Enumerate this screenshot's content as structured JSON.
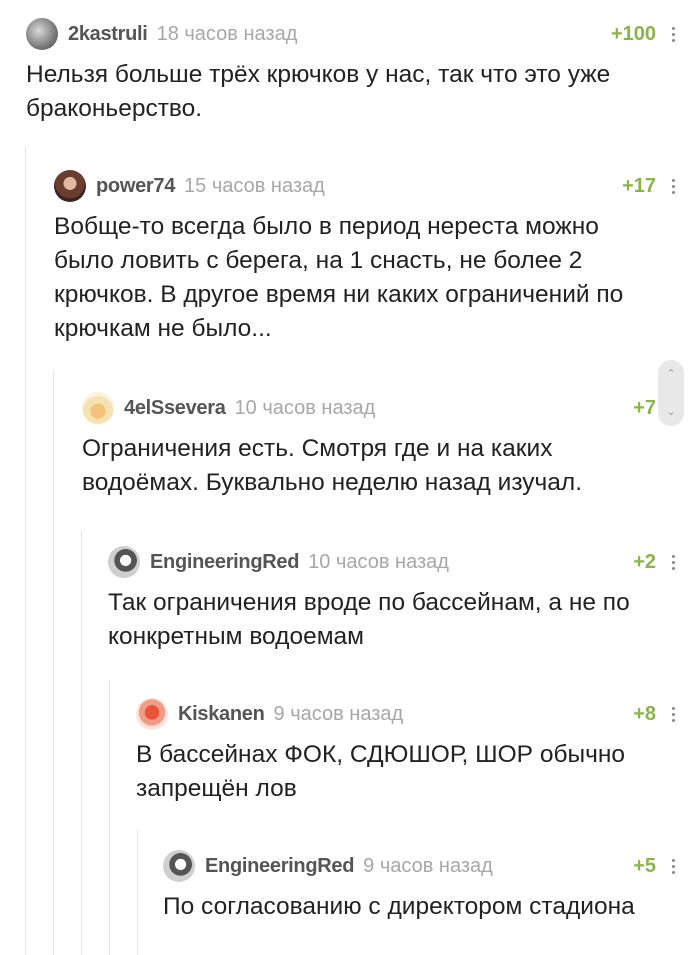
{
  "comments": [
    {
      "user": "2kastruli",
      "time": "18 часов назад",
      "rating": "+100",
      "lines": [
        "Нельзя больше трёх крючков у нас, так что это уже",
        "браконьерство."
      ]
    },
    {
      "user": "power74",
      "time": "15 часов назад",
      "rating": "+17",
      "lines": [
        "Вобще-то всегда было в период нереста можно",
        "было ловить с берега, на 1 снасть, не более 2",
        "крючков. В другое время ни каких ограничений по",
        "крючкам не было..."
      ]
    },
    {
      "user": "4elSsevera",
      "time": "10 часов назад",
      "rating": "+7",
      "lines": [
        "Ограничения есть. Смотря где и на каких",
        "водоёмах. Буквально неделю назад изучал."
      ]
    },
    {
      "user": "EngineeringRed",
      "time": "10 часов назад",
      "rating": "+2",
      "lines": [
        "Так ограничения вроде по бассейнам, а не по",
        "конкретным водоемам"
      ]
    },
    {
      "user": "Kiskanen",
      "time": "9 часов назад",
      "rating": "+8",
      "lines": [
        "В бассейнах ФОК, СДЮШОР, ШОР обычно",
        "запрещён лов"
      ]
    },
    {
      "user": "EngineeringRed",
      "time": "9 часов назад",
      "rating": "+5",
      "lines": [
        "По согласованию с директором стадиона"
      ]
    }
  ],
  "colors": {
    "rating": "#8ab34a",
    "username": "#555555",
    "time": "#a7a7a7"
  },
  "icons": {
    "menu": "vertical-dots-icon",
    "scroll_up": "chevron-up-icon",
    "scroll_down": "chevron-down-icon"
  }
}
